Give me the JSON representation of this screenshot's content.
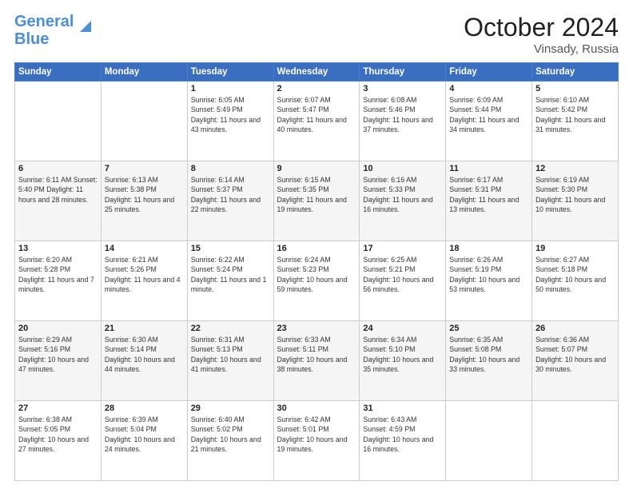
{
  "header": {
    "logo_line1": "General",
    "logo_line2": "Blue",
    "month": "October 2024",
    "location": "Vinsady, Russia"
  },
  "days_of_week": [
    "Sunday",
    "Monday",
    "Tuesday",
    "Wednesday",
    "Thursday",
    "Friday",
    "Saturday"
  ],
  "weeks": [
    [
      {
        "day": "",
        "content": ""
      },
      {
        "day": "",
        "content": ""
      },
      {
        "day": "1",
        "content": "Sunrise: 6:05 AM\nSunset: 5:49 PM\nDaylight: 11 hours and 43 minutes."
      },
      {
        "day": "2",
        "content": "Sunrise: 6:07 AM\nSunset: 5:47 PM\nDaylight: 11 hours and 40 minutes."
      },
      {
        "day": "3",
        "content": "Sunrise: 6:08 AM\nSunset: 5:46 PM\nDaylight: 11 hours and 37 minutes."
      },
      {
        "day": "4",
        "content": "Sunrise: 6:09 AM\nSunset: 5:44 PM\nDaylight: 11 hours and 34 minutes."
      },
      {
        "day": "5",
        "content": "Sunrise: 6:10 AM\nSunset: 5:42 PM\nDaylight: 11 hours and 31 minutes."
      }
    ],
    [
      {
        "day": "6",
        "content": "Sunrise: 6:11 AM\nSunset: 5:40 PM\nDaylight: 11 hours and 28 minutes."
      },
      {
        "day": "7",
        "content": "Sunrise: 6:13 AM\nSunset: 5:38 PM\nDaylight: 11 hours and 25 minutes."
      },
      {
        "day": "8",
        "content": "Sunrise: 6:14 AM\nSunset: 5:37 PM\nDaylight: 11 hours and 22 minutes."
      },
      {
        "day": "9",
        "content": "Sunrise: 6:15 AM\nSunset: 5:35 PM\nDaylight: 11 hours and 19 minutes."
      },
      {
        "day": "10",
        "content": "Sunrise: 6:16 AM\nSunset: 5:33 PM\nDaylight: 11 hours and 16 minutes."
      },
      {
        "day": "11",
        "content": "Sunrise: 6:17 AM\nSunset: 5:31 PM\nDaylight: 11 hours and 13 minutes."
      },
      {
        "day": "12",
        "content": "Sunrise: 6:19 AM\nSunset: 5:30 PM\nDaylight: 11 hours and 10 minutes."
      }
    ],
    [
      {
        "day": "13",
        "content": "Sunrise: 6:20 AM\nSunset: 5:28 PM\nDaylight: 11 hours and 7 minutes."
      },
      {
        "day": "14",
        "content": "Sunrise: 6:21 AM\nSunset: 5:26 PM\nDaylight: 11 hours and 4 minutes."
      },
      {
        "day": "15",
        "content": "Sunrise: 6:22 AM\nSunset: 5:24 PM\nDaylight: 11 hours and 1 minute."
      },
      {
        "day": "16",
        "content": "Sunrise: 6:24 AM\nSunset: 5:23 PM\nDaylight: 10 hours and 59 minutes."
      },
      {
        "day": "17",
        "content": "Sunrise: 6:25 AM\nSunset: 5:21 PM\nDaylight: 10 hours and 56 minutes."
      },
      {
        "day": "18",
        "content": "Sunrise: 6:26 AM\nSunset: 5:19 PM\nDaylight: 10 hours and 53 minutes."
      },
      {
        "day": "19",
        "content": "Sunrise: 6:27 AM\nSunset: 5:18 PM\nDaylight: 10 hours and 50 minutes."
      }
    ],
    [
      {
        "day": "20",
        "content": "Sunrise: 6:29 AM\nSunset: 5:16 PM\nDaylight: 10 hours and 47 minutes."
      },
      {
        "day": "21",
        "content": "Sunrise: 6:30 AM\nSunset: 5:14 PM\nDaylight: 10 hours and 44 minutes."
      },
      {
        "day": "22",
        "content": "Sunrise: 6:31 AM\nSunset: 5:13 PM\nDaylight: 10 hours and 41 minutes."
      },
      {
        "day": "23",
        "content": "Sunrise: 6:33 AM\nSunset: 5:11 PM\nDaylight: 10 hours and 38 minutes."
      },
      {
        "day": "24",
        "content": "Sunrise: 6:34 AM\nSunset: 5:10 PM\nDaylight: 10 hours and 35 minutes."
      },
      {
        "day": "25",
        "content": "Sunrise: 6:35 AM\nSunset: 5:08 PM\nDaylight: 10 hours and 33 minutes."
      },
      {
        "day": "26",
        "content": "Sunrise: 6:36 AM\nSunset: 5:07 PM\nDaylight: 10 hours and 30 minutes."
      }
    ],
    [
      {
        "day": "27",
        "content": "Sunrise: 6:38 AM\nSunset: 5:05 PM\nDaylight: 10 hours and 27 minutes."
      },
      {
        "day": "28",
        "content": "Sunrise: 6:39 AM\nSunset: 5:04 PM\nDaylight: 10 hours and 24 minutes."
      },
      {
        "day": "29",
        "content": "Sunrise: 6:40 AM\nSunset: 5:02 PM\nDaylight: 10 hours and 21 minutes."
      },
      {
        "day": "30",
        "content": "Sunrise: 6:42 AM\nSunset: 5:01 PM\nDaylight: 10 hours and 19 minutes."
      },
      {
        "day": "31",
        "content": "Sunrise: 6:43 AM\nSunset: 4:59 PM\nDaylight: 10 hours and 16 minutes."
      },
      {
        "day": "",
        "content": ""
      },
      {
        "day": "",
        "content": ""
      }
    ]
  ]
}
